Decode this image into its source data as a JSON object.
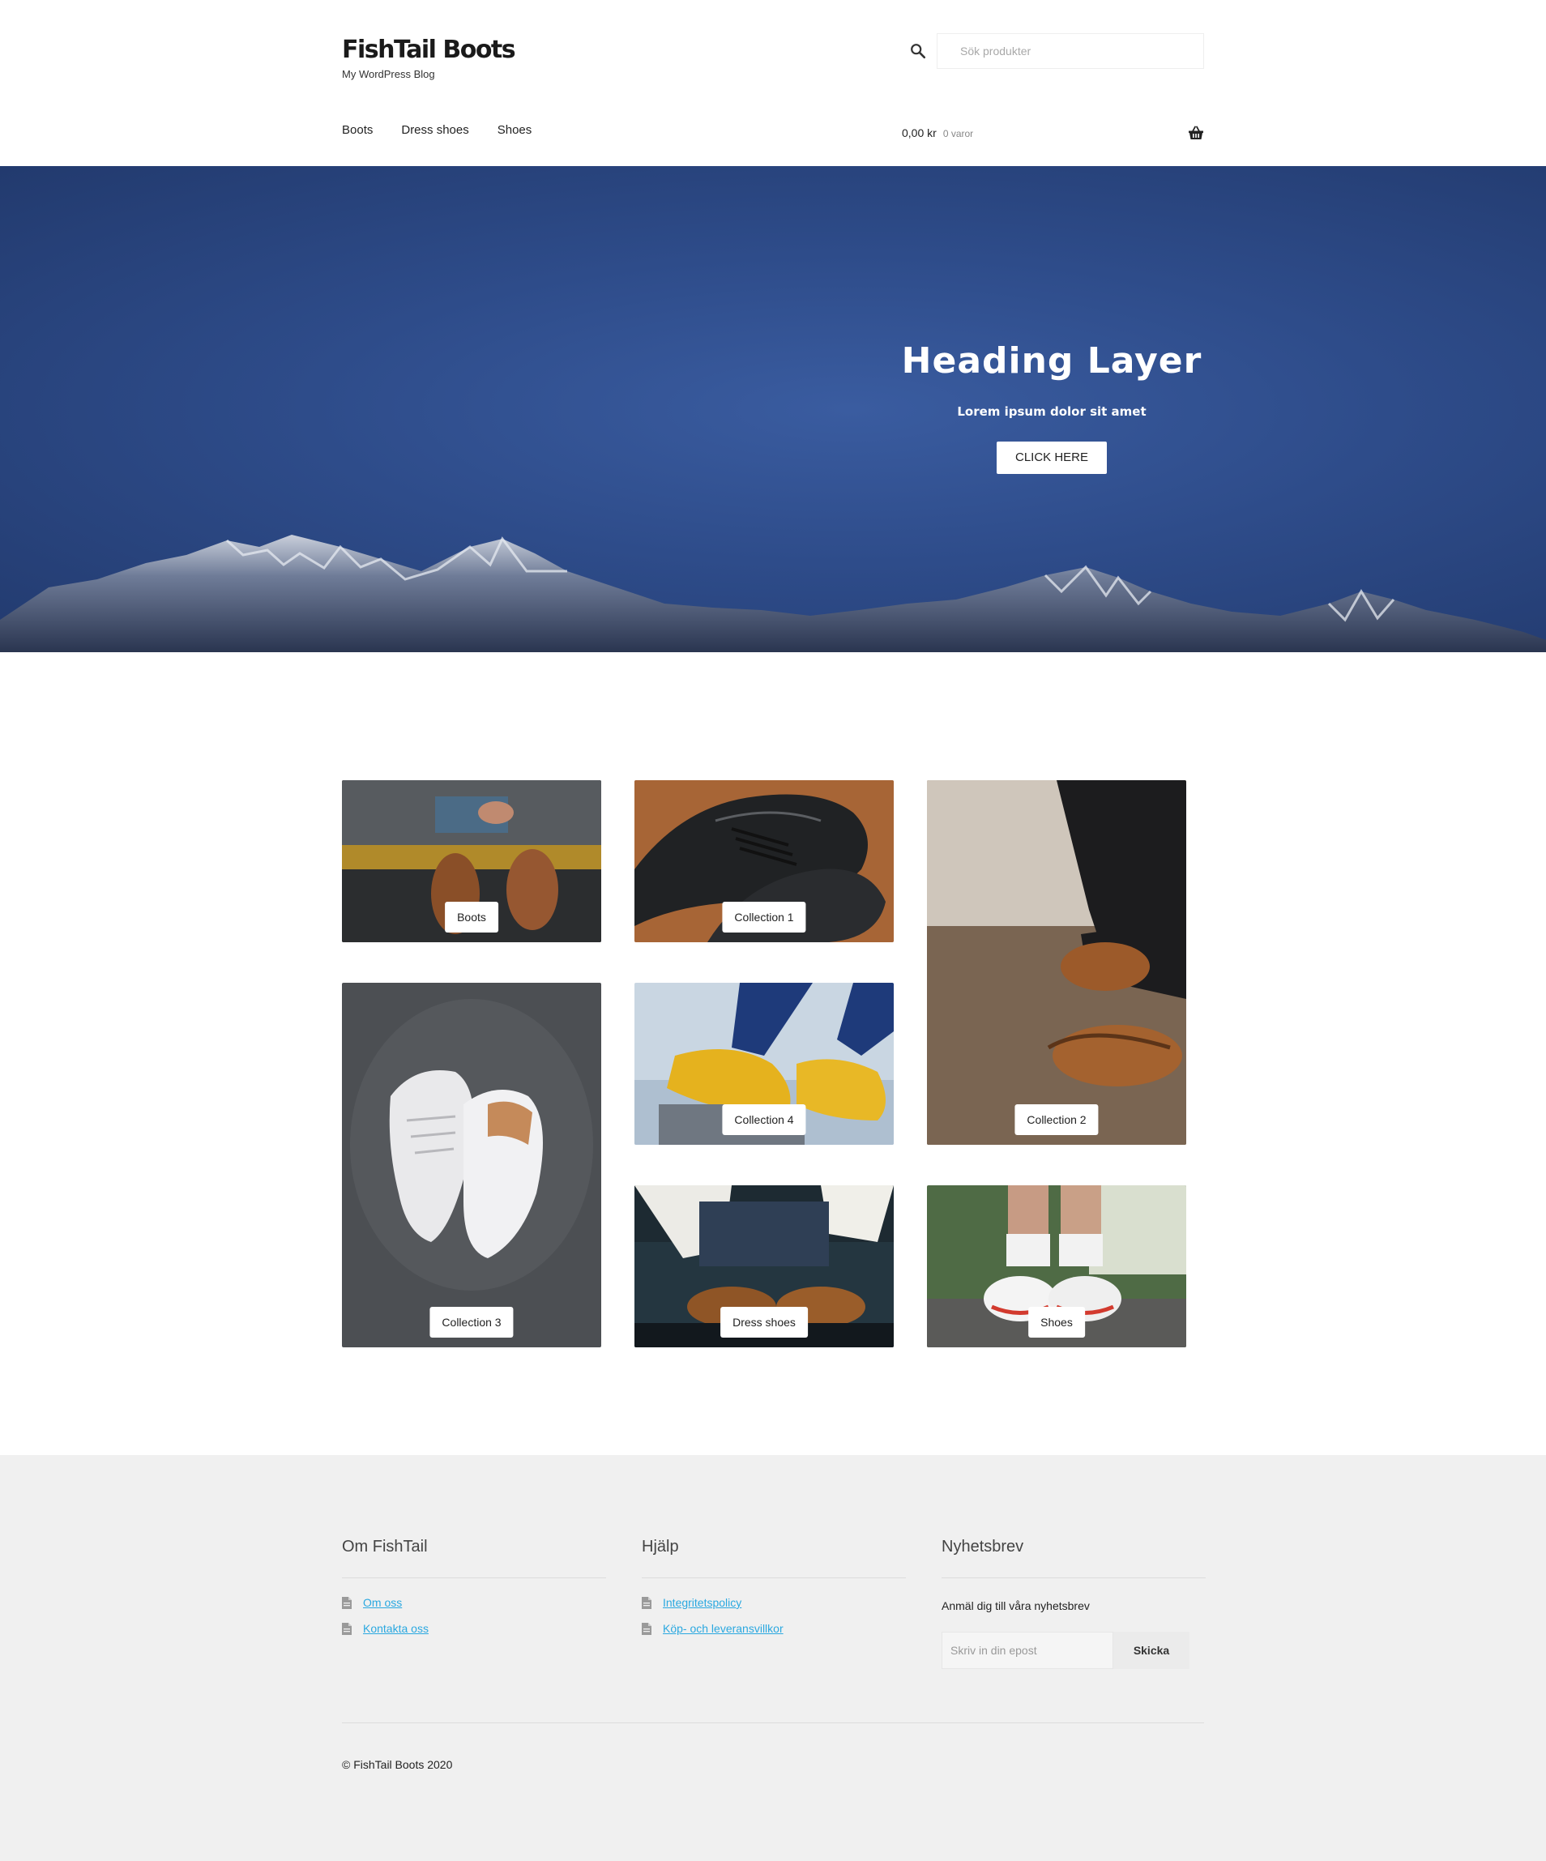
{
  "site": {
    "title": "FishTail Boots",
    "tagline": "My WordPress Blog"
  },
  "search": {
    "placeholder": "Sök produkter",
    "icon": "search-icon"
  },
  "nav": {
    "items": [
      "Boots",
      "Dress shoes",
      "Shoes"
    ]
  },
  "cart": {
    "amount": "0,00 kr",
    "count": "0 varor",
    "icon": "basket-icon"
  },
  "hero": {
    "heading": "Heading Layer",
    "subtitle": "Lorem ipsum dolor sit amet",
    "button": "CLICK HERE"
  },
  "collections": [
    {
      "label": "Boots"
    },
    {
      "label": "Collection 1"
    },
    {
      "label": "Collection 2"
    },
    {
      "label": "Collection 3"
    },
    {
      "label": "Collection 4"
    },
    {
      "label": "Dress shoes"
    },
    {
      "label": "Shoes"
    }
  ],
  "footer": {
    "about": {
      "title": "Om FishTail",
      "links": [
        "Om oss",
        "Kontakta oss"
      ]
    },
    "help": {
      "title": "Hjälp",
      "links": [
        "Integritetspolicy",
        "Köp- och leveransvillkor"
      ]
    },
    "newsletter": {
      "title": "Nyhetsbrev",
      "text": "Anmäl dig till våra nyhetsbrev",
      "placeholder": "Skriv in din epost",
      "button": "Skicka"
    },
    "copyright": "© FishTail Boots 2020"
  },
  "colors": {
    "link": "#2aa8e0",
    "hero_sky": "#2e4c8a",
    "footer_bg": "#f0f0f0"
  }
}
